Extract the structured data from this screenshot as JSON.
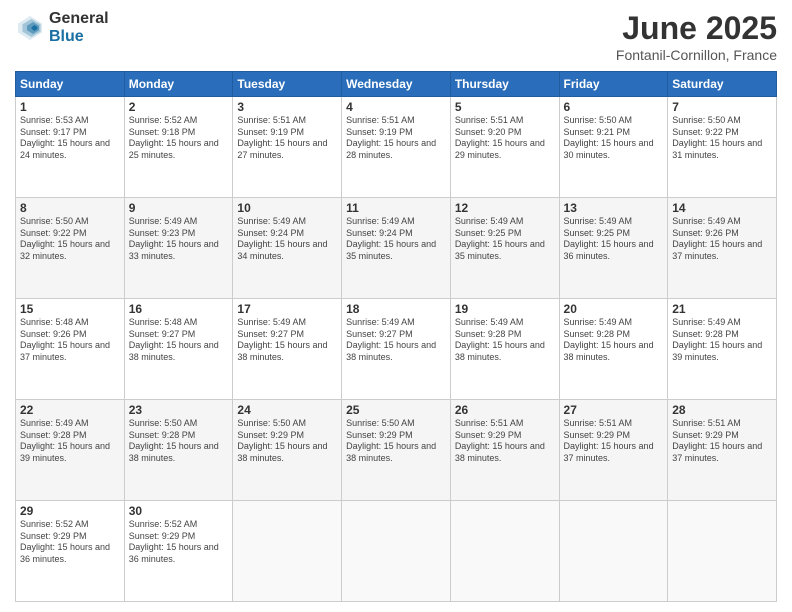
{
  "logo": {
    "general": "General",
    "blue": "Blue"
  },
  "title": "June 2025",
  "location": "Fontanil-Cornillon, France",
  "days_header": [
    "Sunday",
    "Monday",
    "Tuesday",
    "Wednesday",
    "Thursday",
    "Friday",
    "Saturday"
  ],
  "weeks": [
    [
      {
        "num": "1",
        "rise": "5:53 AM",
        "set": "9:17 PM",
        "daylight": "15 hours and 24 minutes."
      },
      {
        "num": "2",
        "rise": "5:52 AM",
        "set": "9:18 PM",
        "daylight": "15 hours and 25 minutes."
      },
      {
        "num": "3",
        "rise": "5:51 AM",
        "set": "9:19 PM",
        "daylight": "15 hours and 27 minutes."
      },
      {
        "num": "4",
        "rise": "5:51 AM",
        "set": "9:19 PM",
        "daylight": "15 hours and 28 minutes."
      },
      {
        "num": "5",
        "rise": "5:51 AM",
        "set": "9:20 PM",
        "daylight": "15 hours and 29 minutes."
      },
      {
        "num": "6",
        "rise": "5:50 AM",
        "set": "9:21 PM",
        "daylight": "15 hours and 30 minutes."
      },
      {
        "num": "7",
        "rise": "5:50 AM",
        "set": "9:22 PM",
        "daylight": "15 hours and 31 minutes."
      }
    ],
    [
      {
        "num": "8",
        "rise": "5:50 AM",
        "set": "9:22 PM",
        "daylight": "15 hours and 32 minutes."
      },
      {
        "num": "9",
        "rise": "5:49 AM",
        "set": "9:23 PM",
        "daylight": "15 hours and 33 minutes."
      },
      {
        "num": "10",
        "rise": "5:49 AM",
        "set": "9:24 PM",
        "daylight": "15 hours and 34 minutes."
      },
      {
        "num": "11",
        "rise": "5:49 AM",
        "set": "9:24 PM",
        "daylight": "15 hours and 35 minutes."
      },
      {
        "num": "12",
        "rise": "5:49 AM",
        "set": "9:25 PM",
        "daylight": "15 hours and 35 minutes."
      },
      {
        "num": "13",
        "rise": "5:49 AM",
        "set": "9:25 PM",
        "daylight": "15 hours and 36 minutes."
      },
      {
        "num": "14",
        "rise": "5:49 AM",
        "set": "9:26 PM",
        "daylight": "15 hours and 37 minutes."
      }
    ],
    [
      {
        "num": "15",
        "rise": "5:48 AM",
        "set": "9:26 PM",
        "daylight": "15 hours and 37 minutes."
      },
      {
        "num": "16",
        "rise": "5:48 AM",
        "set": "9:27 PM",
        "daylight": "15 hours and 38 minutes."
      },
      {
        "num": "17",
        "rise": "5:49 AM",
        "set": "9:27 PM",
        "daylight": "15 hours and 38 minutes."
      },
      {
        "num": "18",
        "rise": "5:49 AM",
        "set": "9:27 PM",
        "daylight": "15 hours and 38 minutes."
      },
      {
        "num": "19",
        "rise": "5:49 AM",
        "set": "9:28 PM",
        "daylight": "15 hours and 38 minutes."
      },
      {
        "num": "20",
        "rise": "5:49 AM",
        "set": "9:28 PM",
        "daylight": "15 hours and 38 minutes."
      },
      {
        "num": "21",
        "rise": "5:49 AM",
        "set": "9:28 PM",
        "daylight": "15 hours and 39 minutes."
      }
    ],
    [
      {
        "num": "22",
        "rise": "5:49 AM",
        "set": "9:28 PM",
        "daylight": "15 hours and 39 minutes."
      },
      {
        "num": "23",
        "rise": "5:50 AM",
        "set": "9:28 PM",
        "daylight": "15 hours and 38 minutes."
      },
      {
        "num": "24",
        "rise": "5:50 AM",
        "set": "9:29 PM",
        "daylight": "15 hours and 38 minutes."
      },
      {
        "num": "25",
        "rise": "5:50 AM",
        "set": "9:29 PM",
        "daylight": "15 hours and 38 minutes."
      },
      {
        "num": "26",
        "rise": "5:51 AM",
        "set": "9:29 PM",
        "daylight": "15 hours and 38 minutes."
      },
      {
        "num": "27",
        "rise": "5:51 AM",
        "set": "9:29 PM",
        "daylight": "15 hours and 37 minutes."
      },
      {
        "num": "28",
        "rise": "5:51 AM",
        "set": "9:29 PM",
        "daylight": "15 hours and 37 minutes."
      }
    ],
    [
      {
        "num": "29",
        "rise": "5:52 AM",
        "set": "9:29 PM",
        "daylight": "15 hours and 36 minutes."
      },
      {
        "num": "30",
        "rise": "5:52 AM",
        "set": "9:29 PM",
        "daylight": "15 hours and 36 minutes."
      },
      null,
      null,
      null,
      null,
      null
    ]
  ]
}
